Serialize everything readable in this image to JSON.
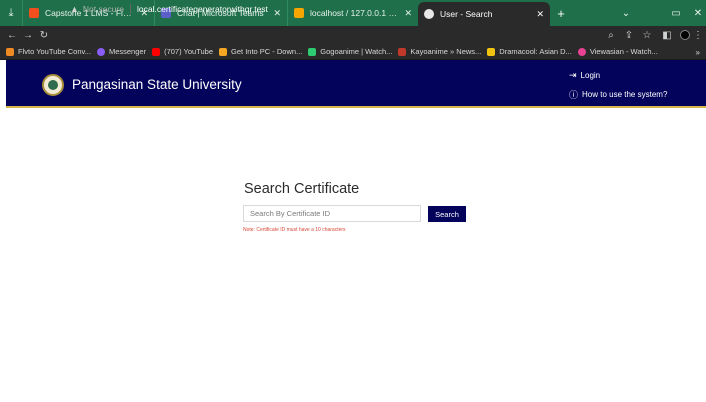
{
  "browser": {
    "tabs": [
      {
        "label": "Capstone 1 LMS - Figma",
        "favicon_color": "#f24e1e",
        "active": false
      },
      {
        "label": "Chat | Microsoft Teams",
        "favicon_color": "#5b5fc7",
        "active": false
      },
      {
        "label": "localhost / 127.0.0.1 / qrcode | p",
        "favicon_color": "#f7a500",
        "active": false
      },
      {
        "label": "User - Search",
        "favicon_color": "#e8e8e8",
        "active": true
      }
    ],
    "new_tab_icon": "+",
    "toolbar": {
      "not_secure_label": "Not secure",
      "url": "local.certificategeneratorwithqr.test"
    },
    "bookmarks": [
      {
        "label": "Flvto YouTube Conv...",
        "color": "#f08a24"
      },
      {
        "label": "Messenger",
        "color": "#8a5cf6"
      },
      {
        "label": "(707) YouTube",
        "color": "#ff0000"
      },
      {
        "label": "Get Into PC - Down...",
        "color": "#f5a623"
      },
      {
        "label": "Gogoanime | Watch...",
        "color": "#2ecc71"
      },
      {
        "label": "Kayoanime » News...",
        "color": "#c0392b"
      },
      {
        "label": "Dramacool: Asian D...",
        "color": "#f1c40f"
      },
      {
        "label": "Viewasian - Watch...",
        "color": "#e84393"
      }
    ],
    "bookmarks_more": "»"
  },
  "site": {
    "brand_name": "Pangasinan State University",
    "login_label": "Login",
    "help_label": "How to use the system?",
    "header_color": "#04035c",
    "accent_color": "#d6b64a"
  },
  "search": {
    "title": "Search Certificate",
    "placeholder": "Search By Certificate ID",
    "button_label": "Search",
    "note": "Note: Certificate ID must have a 10 characters"
  }
}
